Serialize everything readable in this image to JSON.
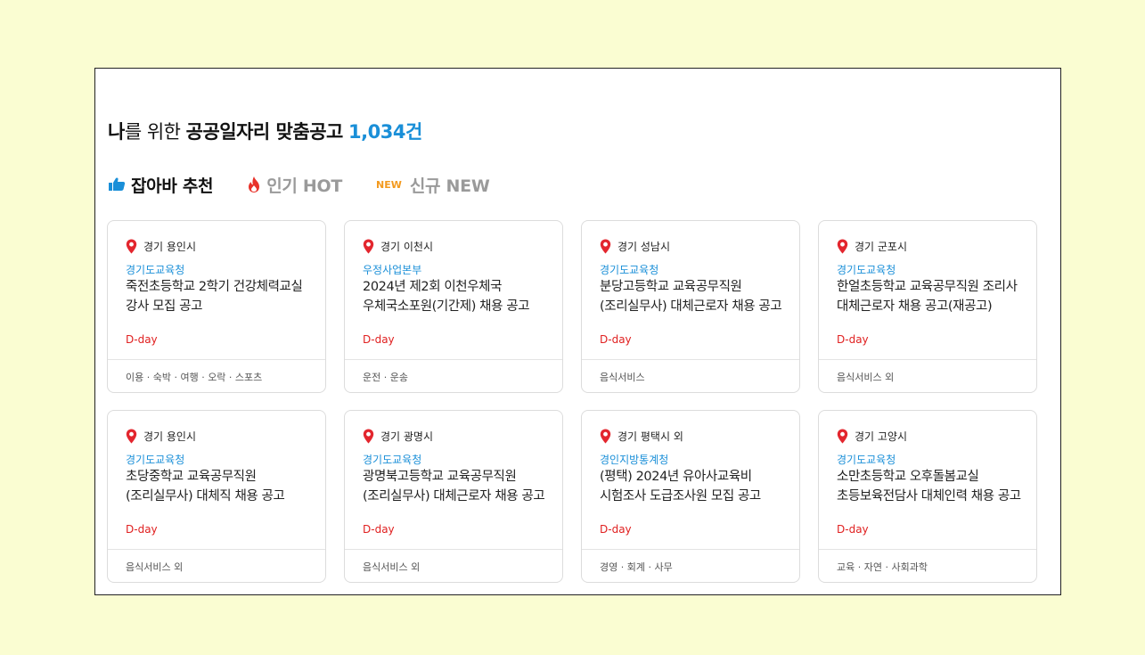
{
  "headline": {
    "prefix": "나",
    "middle": "를 위한 ",
    "main": "공공일자리 맞춤공고",
    "count": "1,034건"
  },
  "tabs": [
    {
      "label": "잡아바 추천",
      "icon": "thumbs-up-icon",
      "active": true
    },
    {
      "label": "인기 HOT",
      "icon": "fire-icon",
      "active": false
    },
    {
      "label": "신규 NEW",
      "badge": "NEW",
      "active": false
    }
  ],
  "colors": {
    "background": "#fafdd2",
    "accent": "#1a8fd8",
    "dday": "#e02020",
    "new_badge": "#f39a1e"
  },
  "jobs": [
    {
      "location": "경기 용인시",
      "org": "경기도교육청",
      "title": "죽전초등학교 2학기 건강체력교실 강사 모집 공고",
      "dday": "D-day",
      "category": "이용 · 숙박 · 여행 · 오락 · 스포츠"
    },
    {
      "location": "경기 이천시",
      "org": "우정사업본부",
      "title": "2024년 제2회 이천우체국 우체국소포원(기간제) 채용 공고",
      "dday": "D-day",
      "category": "운전 · 운송"
    },
    {
      "location": "경기 성남시",
      "org": "경기도교육청",
      "title": "분당고등학교 교육공무직원(조리실무사) 대체근로자 채용 공고",
      "dday": "D-day",
      "category": "음식서비스"
    },
    {
      "location": "경기 군포시",
      "org": "경기도교육청",
      "title": "한얼초등학교 교육공무직원 조리사 대체근로자 채용 공고(재공고)",
      "dday": "D-day",
      "category": "음식서비스  외"
    },
    {
      "location": "경기 용인시",
      "org": "경기도교육청",
      "title": "초당중학교 교육공무직원(조리실무사) 대체직 채용 공고",
      "dday": "D-day",
      "category": "음식서비스  외"
    },
    {
      "location": "경기 광명시",
      "org": "경기도교육청",
      "title": "광명북고등학교 교육공무직원(조리실무사) 대체근로자 채용 공고",
      "dday": "D-day",
      "category": "음식서비스  외"
    },
    {
      "location": "경기 평택시  외",
      "org": "경인지방통계청",
      "title": "(평택) 2024년 유아사교육비 시험조사 도급조사원 모집 공고",
      "dday": "D-day",
      "category": "경영 · 회계 · 사무"
    },
    {
      "location": "경기 고양시",
      "org": "경기도교육청",
      "title": "소만초등학교 오후돌봄교실 초등보육전담사 대체인력 채용 공고",
      "dday": "D-day",
      "category": "교육 · 자연 · 사회과학"
    }
  ]
}
